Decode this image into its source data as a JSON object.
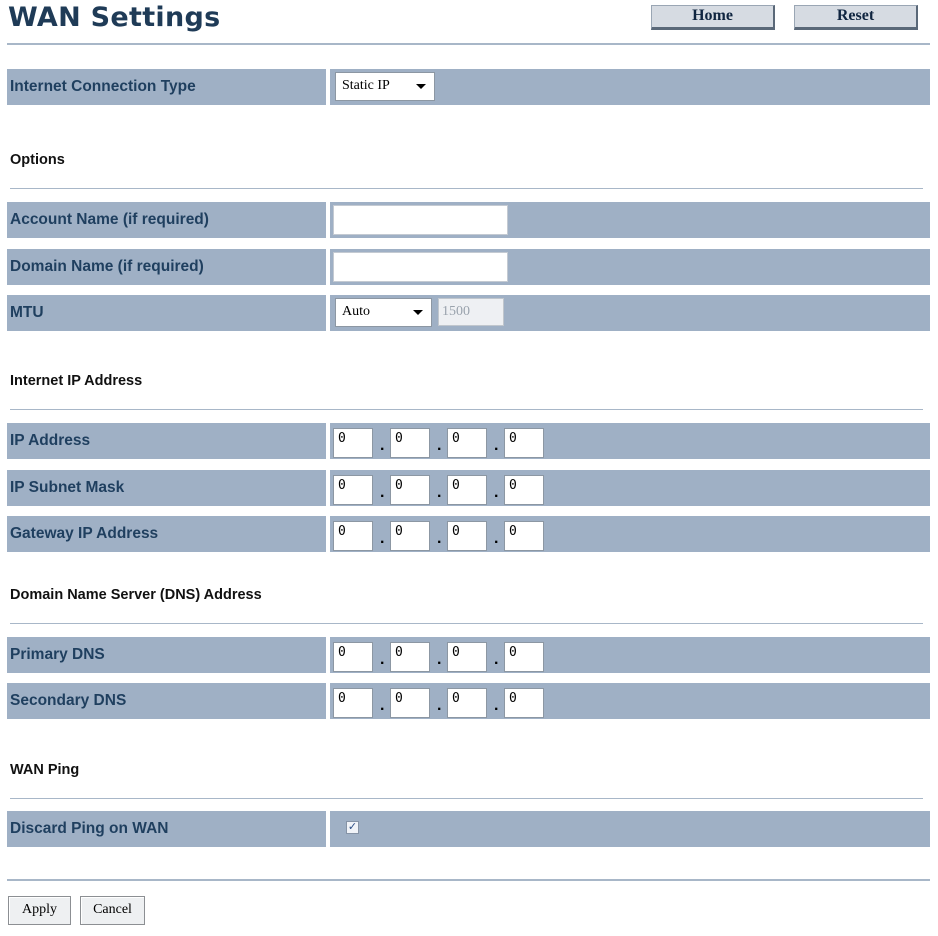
{
  "header": {
    "title": "WAN Settings",
    "home_label": "Home",
    "reset_label": "Reset"
  },
  "connection": {
    "label": "Internet Connection Type",
    "selected": "Static IP"
  },
  "options": {
    "heading": "Options",
    "account_label": "Account Name (if required)",
    "account_value": "",
    "domain_label": "Domain Name (if required)",
    "domain_value": "",
    "mtu_label": "MTU",
    "mtu_mode": "Auto",
    "mtu_value": "1500"
  },
  "internet_ip": {
    "heading": "Internet IP Address",
    "ip_label": "IP Address",
    "ip": [
      "0",
      "0",
      "0",
      "0"
    ],
    "mask_label": "IP Subnet Mask",
    "mask": [
      "0",
      "0",
      "0",
      "0"
    ],
    "gateway_label": "Gateway IP Address",
    "gateway": [
      "0",
      "0",
      "0",
      "0"
    ]
  },
  "dns": {
    "heading": "Domain Name Server (DNS) Address",
    "primary_label": "Primary DNS",
    "primary": [
      "0",
      "0",
      "0",
      "0"
    ],
    "secondary_label": "Secondary DNS",
    "secondary": [
      "0",
      "0",
      "0",
      "0"
    ]
  },
  "wan_ping": {
    "heading": "WAN Ping",
    "discard_label": "Discard Ping on WAN",
    "discard_checked": true
  },
  "footer": {
    "apply_label": "Apply",
    "cancel_label": "Cancel"
  },
  "icons": {
    "dropdown": "chevron-down-icon",
    "checkmark": "check-icon"
  },
  "colors": {
    "row_bg": "#9fb0c5",
    "label_text": "#1f3f5f",
    "title_text": "#1f3b57"
  }
}
